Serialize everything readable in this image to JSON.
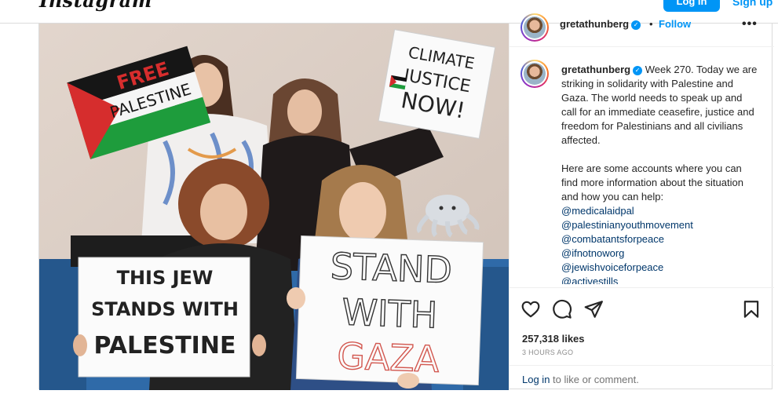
{
  "app": {
    "logo": "Instagram",
    "login_label": "Log in",
    "signup_label": "Sign up"
  },
  "post": {
    "username": "gretathunberg",
    "dot": "•",
    "follow_label": "Follow",
    "more_label": "•••",
    "caption": {
      "username": "gretathunberg",
      "paragraph1": "Week 270. Today we are striking in solidarity with Palestine and Gaza. The world needs to speak up and call for an immediate ceasefire, justice and freedom for Palestinians and all civilians affected.",
      "paragraph2": "Here are some accounts where you can find more information about the situation and how you can help:",
      "mentions": [
        "@medicalaidpal",
        "@palestinianyouthmovement",
        "@combatantsforpeace",
        "@ifnotnoworg",
        "@jewishvoiceforpeace",
        "@activestills"
      ]
    },
    "likes": "257,318 likes",
    "time": "3 HOURS AGO",
    "login_prompt": {
      "link": "Log in",
      "rest": " to like or comment."
    },
    "photo": {
      "sign1": [
        "FREE",
        "PALESTINE"
      ],
      "sign2": [
        "CLIMATE",
        "JUSTICE",
        "NOW!"
      ],
      "sign3": [
        "THIS JEW",
        "STANDS WITH",
        "PALESTINE"
      ],
      "sign4": [
        "STAND",
        "WITH",
        "GAZA"
      ]
    }
  },
  "colors": {
    "accent": "#0095f6",
    "link": "#00376b",
    "border": "#dbdbdb",
    "flag_red": "#d62d2d",
    "flag_green": "#1e9c3c",
    "sofa_blue": "#2f6aa8"
  },
  "icons": {
    "like": "heart-icon",
    "comment": "comment-icon",
    "share": "share-icon",
    "save": "bookmark-icon",
    "verified": "verified-badge-icon"
  }
}
